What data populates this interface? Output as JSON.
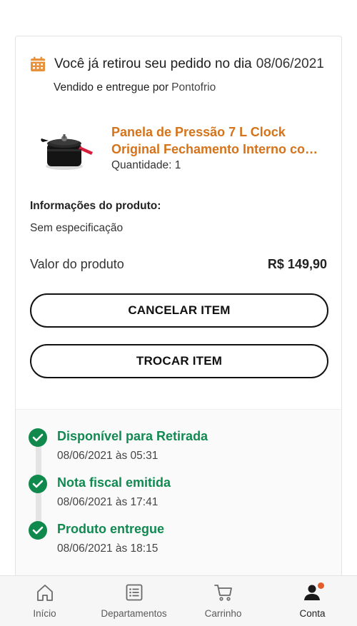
{
  "order": {
    "status_text": "Você já retirou seu pedido no dia",
    "status_date": "08/06/2021",
    "seller_prefix": "Vendido e entregue por",
    "seller_name": "Pontofrio"
  },
  "product": {
    "title_line1": "Panela de Pressão 7 L Clock",
    "title_line2": "Original Fechamento Interno com ...",
    "quantity": "Quantidade: 1",
    "info_label": "Informações do produto:",
    "info_value": "Sem especificação",
    "price_label": "Valor do produto",
    "price_value": "R$ 149,90"
  },
  "actions": {
    "cancel_label": "CANCELAR ITEM",
    "trade_label": "TROCAR ITEM"
  },
  "timeline": [
    {
      "title": "Disponível para Retirada",
      "time": "08/06/2021 às 05:31"
    },
    {
      "title": "Nota fiscal emitida",
      "time": "08/06/2021 às 17:41"
    },
    {
      "title": "Produto entregue",
      "time": "08/06/2021 às 18:15"
    }
  ],
  "nav": {
    "items": [
      {
        "label": "Início",
        "icon": "home-icon"
      },
      {
        "label": "Departamentos",
        "icon": "list-icon"
      },
      {
        "label": "Carrinho",
        "icon": "cart-icon"
      },
      {
        "label": "Conta",
        "icon": "user-icon"
      }
    ],
    "active": "Conta"
  },
  "colors": {
    "accent_orange": "#d5731a",
    "success_green": "#118a52",
    "calendar_icon": "#e8913a",
    "notification_dot": "#e35d2b"
  }
}
